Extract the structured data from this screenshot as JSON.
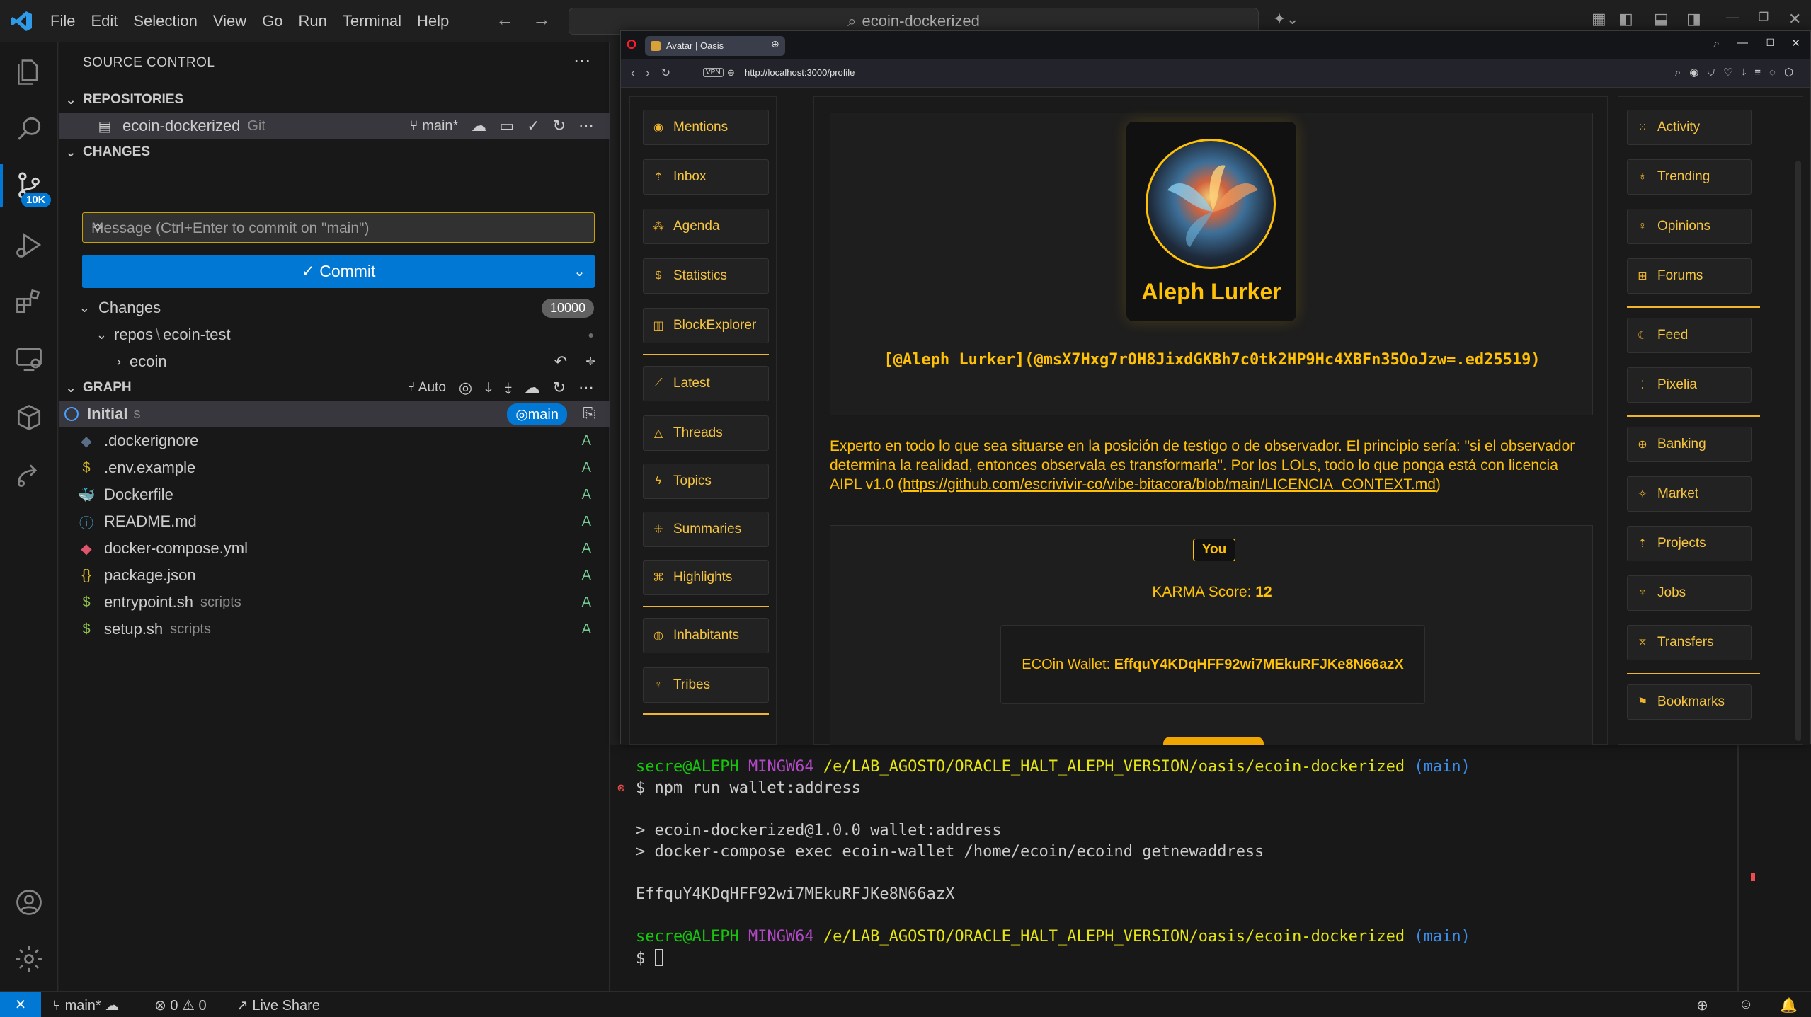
{
  "titlebar": {
    "menu": [
      "File",
      "Edit",
      "Selection",
      "View",
      "Go",
      "Run",
      "Terminal",
      "Help"
    ],
    "search": "ecoin-dockerized"
  },
  "activity": {
    "scm_badge": "10K"
  },
  "sidebar": {
    "title": "SOURCE CONTROL",
    "repositories_label": "REPOSITORIES",
    "repo_name": "ecoin-dockerized",
    "repo_type": "Git",
    "repo_branch": "main*",
    "changes_label": "CHANGES",
    "commit_placeholder": "Message (Ctrl+Enter to commit on \"main\")",
    "commit_button": "✓ Commit",
    "changes_group": "Changes",
    "changes_count": "10000",
    "tree_path_a": "repos",
    "tree_path_sep": "\\",
    "tree_path_b": "ecoin-test",
    "tree_folder": "ecoin",
    "graph_label": "GRAPH",
    "graph_auto": "Auto",
    "commit_title": "Initial",
    "commit_author": "s",
    "commit_branch": "main",
    "files": [
      {
        "name": ".dockerignore",
        "dir": "",
        "status": "A"
      },
      {
        "name": ".env.example",
        "dir": "",
        "status": "A"
      },
      {
        "name": "Dockerfile",
        "dir": "",
        "status": "A"
      },
      {
        "name": "README.md",
        "dir": "",
        "status": "A"
      },
      {
        "name": "docker-compose.yml",
        "dir": "",
        "status": "A"
      },
      {
        "name": "package.json",
        "dir": "",
        "status": "A"
      },
      {
        "name": "entrypoint.sh",
        "dir": "scripts",
        "status": "A"
      },
      {
        "name": "setup.sh",
        "dir": "scripts",
        "status": "A"
      }
    ]
  },
  "browser": {
    "tab_title": "Avatar | Oasis",
    "url": "http://localhost:3000/profile",
    "vpn": "VPN",
    "left_nav": [
      "Mentions",
      "Inbox",
      "Agenda",
      "Statistics",
      "BlockExplorer",
      "Latest",
      "Threads",
      "Topics",
      "Summaries",
      "Highlights",
      "Inhabitants",
      "Tribes"
    ],
    "right_nav": [
      "Activity",
      "Trending",
      "Opinions",
      "Forums",
      "Feed",
      "Pixelia",
      "Banking",
      "Market",
      "Projects",
      "Jobs",
      "Transfers",
      "Bookmarks"
    ],
    "profile_name": "Aleph Lurker",
    "profile_id": "[@Aleph Lurker](@msX7Hxg7rOH8JixdGKBh7c0tk2HP9Hc4XBFn35OoJzw=.ed25519)",
    "bio_text": "Experto en todo lo que sea situarse en la posición de testigo o de observador. El principio sería: \"si el observador determina la realidad, entonces observala es transformarla\". Por los LOLs, todo lo que ponga está con licencia AIPL v1.0 (",
    "bio_link": "https://github.com/escrivivir-co/vibe-bitacora/blob/main/LICENCIA_CONTEXT.md",
    "bio_end": ")",
    "you_label": "You",
    "karma_label": "KARMA Score:",
    "karma_value": "12",
    "wallet_label": "ECOin Wallet:",
    "wallet_value": "EffquY4KDqHFF92wi7MEkuRFJKe8N66azX"
  },
  "terminal": {
    "prompt_user": "secre@ALEPH",
    "prompt_env": "MINGW64",
    "prompt_path": "/e/LAB_AGOSTO/ORACLE_HALT_ALEPH_VERSION/oasis/ecoin-dockerized",
    "prompt_branch": "(main)",
    "cmd": "$ npm run wallet:address",
    "out1": "> ecoin-dockerized@1.0.0 wallet:address",
    "out2": "> docker-compose exec ecoin-wallet /home/ecoin/ecoind getnewaddress",
    "out3": "EffquY4KDqHFF92wi7MEkuRFJKe8N66azX",
    "prompt2": "$"
  },
  "statusbar": {
    "branch": "main*",
    "errors": "0",
    "warnings": "0",
    "live_share": "Live Share"
  },
  "colors": {
    "accent": "#0078d4",
    "oasis_yellow": "#ffc107",
    "added": "#73c991"
  }
}
